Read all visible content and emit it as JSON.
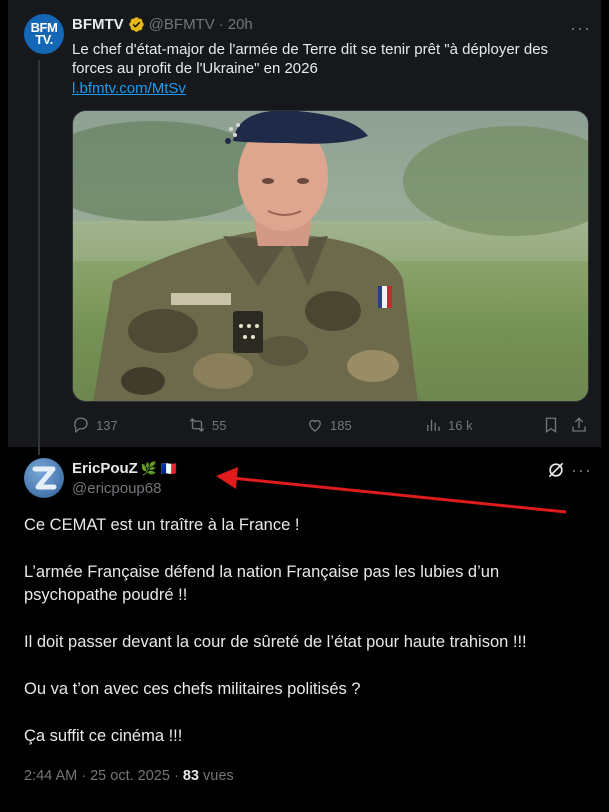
{
  "original_post": {
    "avatar_text_line1": "BFM",
    "avatar_text_line2": "TV.",
    "name": "BFMTV",
    "handle": "@BFMTV",
    "separator": "·",
    "time": "20h",
    "more": "···",
    "text": "Le chef d'état-major de l'armée de Terre dit se tenir prêt \"à déployer des forces au profit de l'Ukraine\" en 2026",
    "link": "l.bfmtv.com/MtSv",
    "image_alt": "general-portrait-photo",
    "actions": {
      "replies": "137",
      "reposts": "55",
      "likes": "185",
      "views": "16 k"
    }
  },
  "reply": {
    "name": "EricPouZ",
    "emoji": "🌿 🇫🇷",
    "handle": "@ericpoup68",
    "more": "···",
    "paragraphs": [
      "Ce CEMAT est un traître à la France !",
      "L’armée Française défend la nation Française pas les lubies d’un psychopathe poudré !!",
      "Il doit passer devant la cour de sûreté de l’état pour haute trahison !!!",
      "Ou va t’on avec ces chefs militaires politisés ?",
      "Ça suffit ce cinéma !!!"
    ],
    "time": "2:44 AM",
    "sep": "·",
    "date": "25 oct. 2025",
    "views_count": "83",
    "views_label": "vues"
  },
  "colors": {
    "background": "#000000",
    "card": "#16181c",
    "text": "#e7e9ea",
    "muted": "#71767b",
    "link": "#1d9bf0",
    "verified": "#e2b719",
    "annotation_arrow": "#e01b1b"
  }
}
